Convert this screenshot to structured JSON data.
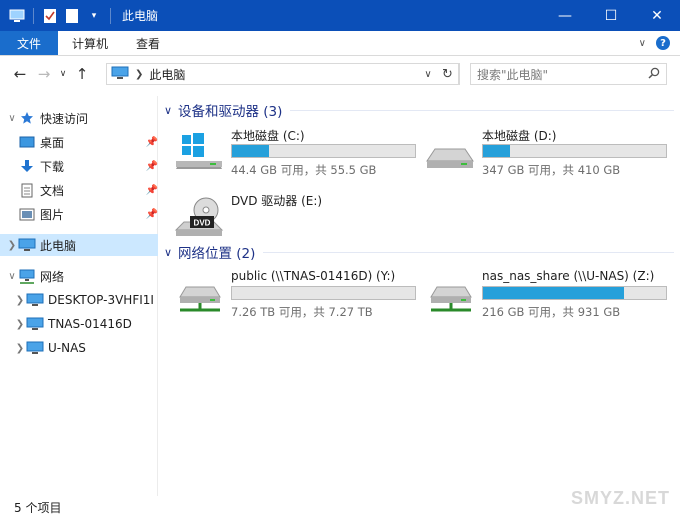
{
  "window": {
    "title": "此电脑"
  },
  "ribbon": {
    "tabs": [
      "文件",
      "计算机",
      "查看"
    ]
  },
  "address": {
    "path": "此电脑",
    "search_placeholder": "搜索\"此电脑\""
  },
  "sidebar": {
    "items": [
      {
        "label": "快速访问",
        "icon": "star-icon"
      },
      {
        "label": "桌面",
        "icon": "desktop-icon",
        "pinned": true
      },
      {
        "label": "下载",
        "icon": "download-icon",
        "pinned": true
      },
      {
        "label": "文档",
        "icon": "document-icon",
        "pinned": true
      },
      {
        "label": "图片",
        "icon": "picture-icon",
        "pinned": true
      },
      {
        "label": "此电脑",
        "icon": "computer-icon",
        "selected": true
      },
      {
        "label": "网络",
        "icon": "network-icon"
      },
      {
        "label": "DESKTOP-3VHFI1I",
        "icon": "computer-icon"
      },
      {
        "label": "TNAS-01416D",
        "icon": "computer-icon"
      },
      {
        "label": "U-NAS",
        "icon": "computer-icon"
      }
    ]
  },
  "groups": [
    {
      "title": "设备和驱动器 (3)",
      "drives": [
        {
          "name": "本地磁盘 (C:)",
          "size": "44.4 GB 可用，共 55.5 GB",
          "used_fraction": 0.2,
          "icon": "windows-drive-icon"
        },
        {
          "name": "本地磁盘 (D:)",
          "size": "347 GB 可用，共 410 GB",
          "used_fraction": 0.15,
          "icon": "hard-drive-icon"
        },
        {
          "name": "DVD 驱动器 (E:)",
          "size": "",
          "icon": "dvd-drive-icon"
        }
      ]
    },
    {
      "title": "网络位置 (2)",
      "drives": [
        {
          "name": "public (\\\\TNAS-01416D) (Y:)",
          "size": "7.26 TB 可用，共 7.27 TB",
          "used_fraction": 0.0,
          "icon": "network-drive-icon"
        },
        {
          "name": "nas_nas_share (\\\\U-NAS) (Z:)",
          "size": "216 GB 可用，共 931 GB",
          "used_fraction": 0.77,
          "icon": "network-drive-icon"
        }
      ]
    }
  ],
  "status": {
    "item_count": "5 个项目"
  },
  "watermark": "SMYZ.NET",
  "colors": {
    "titlebar": "#0b4fb8",
    "file_tab": "#1a6dcc",
    "selection": "#cce8ff",
    "usage_bar": "#26a0da",
    "group_header": "#1e3287"
  }
}
